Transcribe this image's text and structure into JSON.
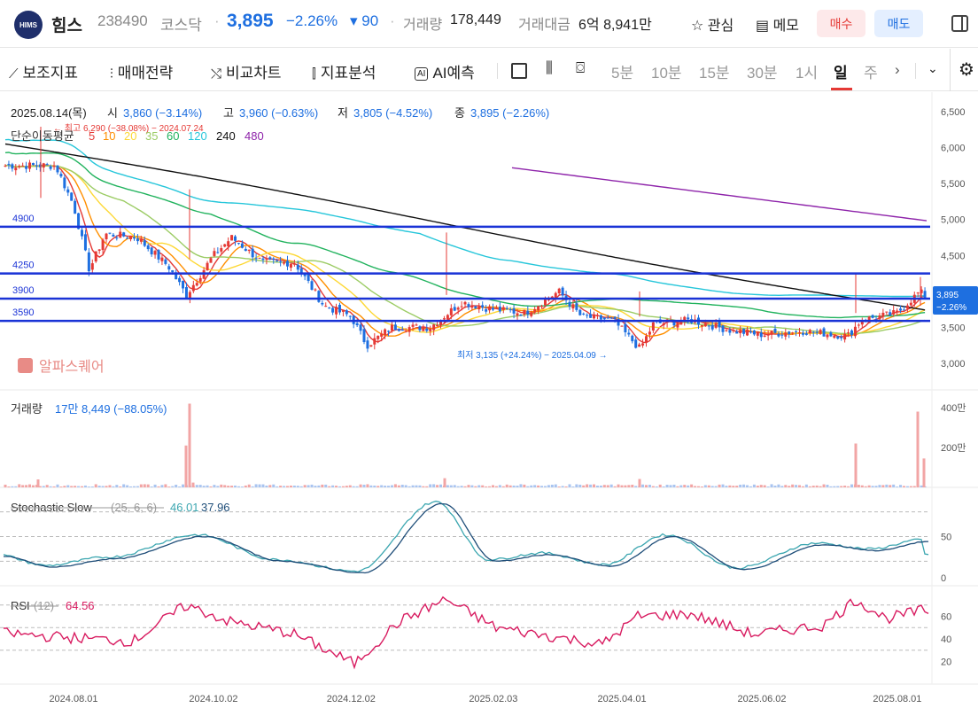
{
  "header": {
    "logo_text": "HIMS",
    "name": "힘스",
    "code": "238490",
    "market": "코스닥",
    "price": "3,895",
    "change_pct": "−2.26%",
    "change_abs": "▾ 90",
    "volume_label": "거래량",
    "volume": "178,449",
    "amount_label": "거래대금",
    "amount": "6억 8,941만",
    "watch": "관심",
    "memo": "메모",
    "buy": "매수",
    "sell": "매도"
  },
  "toolbar": {
    "aux_indicator": "보조지표",
    "strategy": "매매전략",
    "compare": "비교차트",
    "analysis": "지표분석",
    "ai": "AI예측",
    "ai_badge": "AI",
    "timeframes": [
      "5분",
      "10분",
      "15분",
      "30분",
      "1시",
      "일",
      "주"
    ],
    "active_timeframe": "일",
    "more": "›"
  },
  "price_panel": {
    "ohlc_date": "2025.08.14(목)",
    "open_label": "시",
    "open": "3,860 (−3.14%)",
    "high_label": "고",
    "high": "3,960 (−0.63%)",
    "low_label": "저",
    "low": "3,805 (−4.52%)",
    "close_label": "종",
    "close": "3,895 (−2.26%)",
    "ma_label": "단순이동평균",
    "ma_periods": [
      {
        "p": "5",
        "color": "#e53935"
      },
      {
        "p": "10",
        "color": "#ff8f00"
      },
      {
        "p": "20",
        "color": "#fdd835"
      },
      {
        "p": "35",
        "color": "#9ccc65"
      },
      {
        "p": "60",
        "color": "#22b35e"
      },
      {
        "p": "120",
        "color": "#26c6da"
      },
      {
        "p": "240",
        "color": "#111111"
      },
      {
        "p": "480",
        "color": "#8e24aa"
      }
    ],
    "high_note": "← 최고 6,290 (−38.08%) − 2024.07.24",
    "low_note": "최저 3,135 (+24.24%) − 2025.04.09 →",
    "watermark": "알파스퀘어",
    "hlines": [
      {
        "label": "4900",
        "value": 4900
      },
      {
        "label": "4250",
        "value": 4250
      },
      {
        "label": "3900",
        "value": 3900
      },
      {
        "label": "3590",
        "value": 3590
      }
    ],
    "last_price_tag": "3,895",
    "last_change_tag": "−2.26%",
    "y_ticks": [
      "6,500",
      "6,000",
      "5,500",
      "5,000",
      "4,500",
      "4,000",
      "3,500",
      "3,000"
    ]
  },
  "volume_panel": {
    "label": "거래량",
    "value": "17만 8,449 (−88.05%)",
    "y_ticks": [
      "400만",
      "200만"
    ]
  },
  "stoch_panel": {
    "label": "Stochastic Slow",
    "params": "(25, 6, 6)",
    "k": "46.01",
    "d": "37.96",
    "y_ticks": [
      "50",
      "0"
    ]
  },
  "rsi_panel": {
    "label": "RSI",
    "params": "(12)",
    "value": "64.56",
    "y_ticks": [
      "60",
      "40",
      "20"
    ]
  },
  "x_axis": [
    "2024.08.01",
    "2024.10.02",
    "2024.12.02",
    "2025.02.03",
    "2025.04.01",
    "2025.06.02",
    "2025.08.01"
  ],
  "colors": {
    "up": "#e53935",
    "down": "#1e6fe0",
    "hline": "#1a33d6",
    "accent_blue": "#1e6fe0",
    "rsi": "#d81b60",
    "stoch_k": "#3ba6b0",
    "stoch_d": "#1f4e79"
  },
  "chart_data": {
    "type": "candlestick",
    "price_range": [
      3000,
      6500
    ],
    "close_path": [
      {
        "x": "2024.07.24",
        "y": 5750
      },
      {
        "x": "2024.08.01",
        "y": 5200
      },
      {
        "x": "2024.08.08",
        "y": 4300
      },
      {
        "x": "2024.08.15",
        "y": 4800
      },
      {
        "x": "2024.08.29",
        "y": 4750
      },
      {
        "x": "2024.09.12",
        "y": 4350
      },
      {
        "x": "2024.09.20",
        "y": 3950
      },
      {
        "x": "2024.10.02",
        "y": 4500
      },
      {
        "x": "2024.10.10",
        "y": 4750
      },
      {
        "x": "2024.10.24",
        "y": 4400
      },
      {
        "x": "2024.11.07",
        "y": 4400
      },
      {
        "x": "2024.11.20",
        "y": 3800
      },
      {
        "x": "2024.12.02",
        "y": 3650
      },
      {
        "x": "2024.12.09",
        "y": 3250
      },
      {
        "x": "2024.12.20",
        "y": 3500
      },
      {
        "x": "2025.01.06",
        "y": 3500
      },
      {
        "x": "2025.01.20",
        "y": 3850
      },
      {
        "x": "2025.02.03",
        "y": 3750
      },
      {
        "x": "2025.02.17",
        "y": 3700
      },
      {
        "x": "2025.03.04",
        "y": 4000
      },
      {
        "x": "2025.03.14",
        "y": 3650
      },
      {
        "x": "2025.03.28",
        "y": 3600
      },
      {
        "x": "2025.04.09",
        "y": 3200
      },
      {
        "x": "2025.04.15",
        "y": 3550
      },
      {
        "x": "2025.05.02",
        "y": 3600
      },
      {
        "x": "2025.05.20",
        "y": 3450
      },
      {
        "x": "2025.06.02",
        "y": 3400
      },
      {
        "x": "2025.06.20",
        "y": 3450
      },
      {
        "x": "2025.07.10",
        "y": 3380
      },
      {
        "x": "2025.07.16",
        "y": 3600
      },
      {
        "x": "2025.08.01",
        "y": 3700
      },
      {
        "x": "2025.08.11",
        "y": 4000
      },
      {
        "x": "2025.08.14",
        "y": 3895
      }
    ]
  }
}
